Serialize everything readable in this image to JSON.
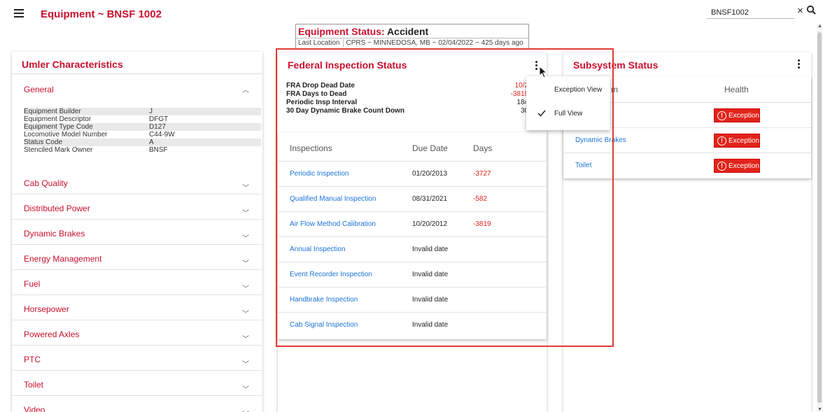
{
  "header": {
    "title": "Equipment ~ BNSF 1002",
    "search_value": "BNSF1002"
  },
  "equipment_status": {
    "label": "Equipment Status:",
    "value": "Accident",
    "last_location_label": "Last Location",
    "last_location_value": "CPRS ~ MINNEDOSA, MB ~ 02/04/2022 ~ 425 days ago"
  },
  "umler": {
    "title": "Umler Characteristics",
    "general_label": "General",
    "attributes": [
      {
        "key": "Equipment Builder",
        "value": "J"
      },
      {
        "key": "Equipment Descriptor",
        "value": "DFGT"
      },
      {
        "key": "Equipment Type Code",
        "value": "D127"
      },
      {
        "key": "Locomotive Model Number",
        "value": "C44-9W"
      },
      {
        "key": "Status Code",
        "value": "A"
      },
      {
        "key": "Stenciled Mark Owner",
        "value": "BNSF"
      }
    ],
    "sections": [
      "Cab Quality",
      "Distributed Power",
      "Dynamic Brakes",
      "Energy Management",
      "Fuel",
      "Horsepower",
      "Powered Axles",
      "PTC",
      "Toilet",
      "Video"
    ]
  },
  "federal": {
    "title": "Federal Inspection Status",
    "metrics": [
      {
        "label": "FRA Drop Dead Date",
        "value": "10/20/2",
        "red": true
      },
      {
        "label": "FRA Days to Dead",
        "value": "-3819 da",
        "red": true
      },
      {
        "label": "Periodic Insp Interval",
        "value": "184 da",
        "red": false
      },
      {
        "label": "30 Day Dynamic Brake Count Down",
        "value": "30 da",
        "red": false
      }
    ],
    "columns": [
      "Inspections",
      "Due Date",
      "Days"
    ],
    "rows": [
      {
        "name": "Periodic Inspection",
        "due": "01/20/2013",
        "days": "-3727"
      },
      {
        "name": "Qualified Manual Inspection",
        "due": "08/31/2021",
        "days": "-582"
      },
      {
        "name": "Air Flow Method Calibration",
        "due": "10/20/2012",
        "days": "-3819"
      },
      {
        "name": "Annual Inspection",
        "due": "Invalid date",
        "days": ""
      },
      {
        "name": "Event Recorder Inspection",
        "due": "Invalid date",
        "days": ""
      },
      {
        "name": "Handbrake Inspection",
        "due": "Invalid date",
        "days": ""
      },
      {
        "name": "Cab Signal Inspection",
        "due": "Invalid date",
        "days": ""
      }
    ]
  },
  "menu": {
    "items": [
      "Exception View",
      "Full View"
    ],
    "checked": "Full View"
  },
  "subsystem": {
    "title": "Subsystem Status",
    "col_system_partial": "m",
    "col_health": "Health",
    "rows": [
      {
        "name": "e",
        "status": "Exception"
      },
      {
        "name": "Dynamic Brakes",
        "status": "Exception"
      },
      {
        "name": "Toilet",
        "status": "Exception"
      }
    ]
  },
  "colors": {
    "brand_red": "#c8102e",
    "link_blue": "#1a73d9",
    "exception_red": "#e2231a",
    "highlight_red": "#e53935"
  }
}
